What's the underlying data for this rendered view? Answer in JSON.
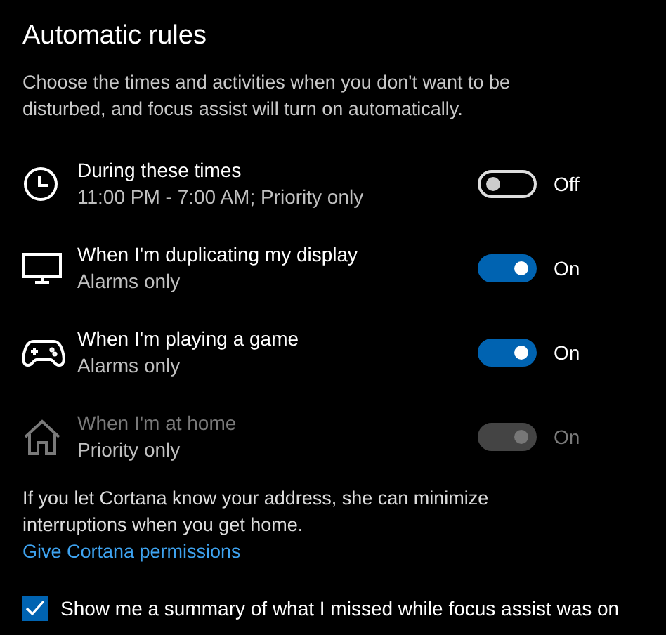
{
  "heading": "Automatic rules",
  "description": "Choose the times and activities when you don't want to be disturbed, and focus assist will turn on automatically.",
  "rules": [
    {
      "kind": "clock",
      "title": "During these times",
      "subtitle": "11:00 PM - 7:00 AM; Priority only",
      "on": false,
      "state_label": "Off",
      "disabled": false
    },
    {
      "kind": "monitor",
      "title": "When I'm duplicating my display",
      "subtitle": "Alarms only",
      "on": true,
      "state_label": "On",
      "disabled": false
    },
    {
      "kind": "gamepad",
      "title": "When I'm playing a game",
      "subtitle": "Alarms only",
      "on": true,
      "state_label": "On",
      "disabled": false
    },
    {
      "kind": "home",
      "title": "When I'm at home",
      "subtitle": "Priority only",
      "on": true,
      "state_label": "On",
      "disabled": true
    }
  ],
  "note": "If you let Cortana know your address, she can minimize interruptions when you get home.",
  "link": "Give Cortana permissions",
  "summary": {
    "label": "Show me a summary of what I missed while focus assist was on",
    "checked": true
  }
}
